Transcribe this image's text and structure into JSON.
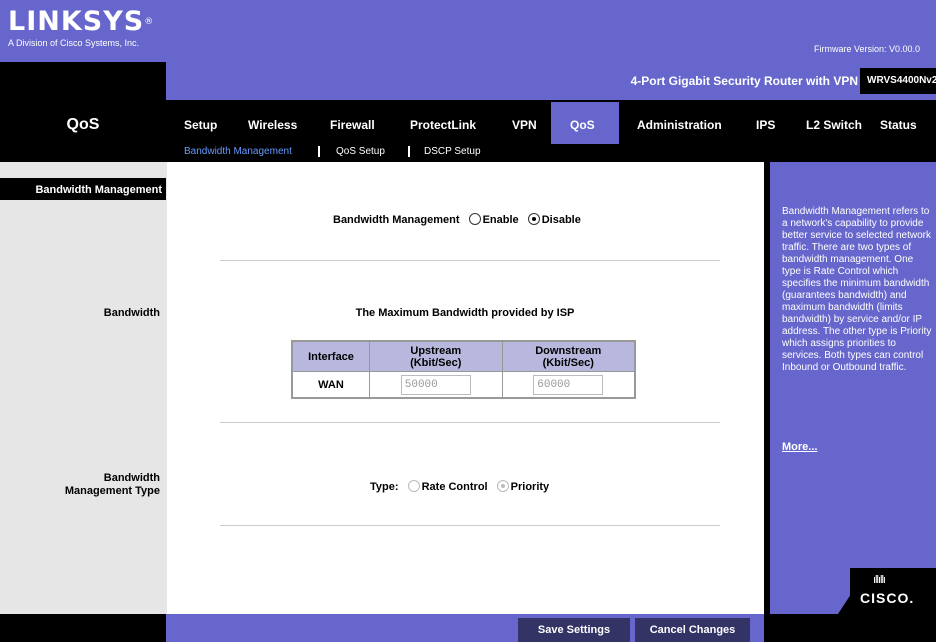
{
  "header": {
    "logo_text": "LINKSYS",
    "logo_reg": "®",
    "logo_subtitle": "A Division of Cisco Systems, Inc.",
    "firmware": "Firmware Version: V0.00.0"
  },
  "model_bar": {
    "product_name": "4-Port Gigabit Security Router with VPN",
    "model_number": "WRVS4400Nv2"
  },
  "section_title": "QoS",
  "tabs": [
    {
      "label": "Setup"
    },
    {
      "label": "Wireless"
    },
    {
      "label": "Firewall"
    },
    {
      "label": "ProtectLink"
    },
    {
      "label": "VPN"
    },
    {
      "label": "QoS",
      "active": true
    },
    {
      "label": "Administration"
    },
    {
      "label": "IPS"
    },
    {
      "label": "L2 Switch"
    },
    {
      "label": "Status"
    }
  ],
  "subtabs": [
    {
      "label": "Bandwidth Management",
      "active": true
    },
    {
      "label": "QoS Setup"
    },
    {
      "label": "DSCP Setup"
    }
  ],
  "left": {
    "heading": "Bandwidth Management",
    "bandwidth_label": "Bandwidth",
    "type_label_line1": "Bandwidth",
    "type_label_line2": "Management Type"
  },
  "main": {
    "bw_mgmt_label": "Bandwidth Management",
    "enable_label": "Enable",
    "disable_label": "Disable",
    "bw_mgmt_selected": "Disable",
    "isp_title": "The Maximum Bandwidth provided by ISP",
    "table": {
      "headers": [
        "Interface",
        "Upstream (Kbit/Sec)",
        "Downstream (Kbit/Sec)"
      ],
      "header_upstream_1": "Upstream",
      "header_upstream_2": "(Kbit/Sec)",
      "header_downstream_1": "Downstream",
      "header_downstream_2": "(Kbit/Sec)",
      "rows": [
        {
          "interface": "WAN",
          "upstream": "50000",
          "downstream": "60000"
        }
      ]
    },
    "type_label": "Type:",
    "rate_control_label": "Rate Control",
    "priority_label": "Priority",
    "type_selected": "Priority"
  },
  "help": {
    "text": "Bandwidth Management refers to a network's capability to provide better service to selected network traffic. There are two types of bandwidth management. One type is Rate Control which specifies the minimum bandwidth (guarantees bandwidth) and maximum bandwidth (limits bandwidth) by service and/or IP address. The other type is Priority which assigns priorities to services. Both types can control Inbound or Outbound traffic.",
    "more_link": "More...",
    "brand": "CISCO."
  },
  "footer": {
    "save_label": "Save Settings",
    "cancel_label": "Cancel Changes"
  },
  "colors": {
    "brand_purple": "#6666cc",
    "table_header": "#b8b8de",
    "button_bg": "#333366",
    "active_subtab": "#6699ff"
  }
}
